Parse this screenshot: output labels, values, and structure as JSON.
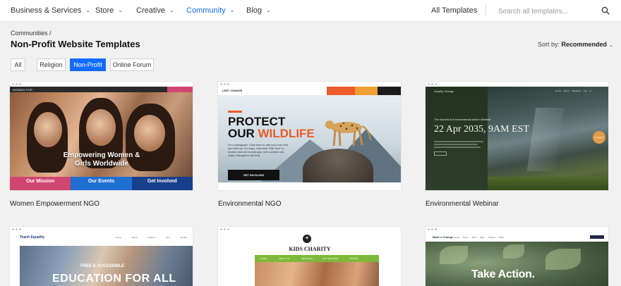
{
  "nav": {
    "items": [
      {
        "label": "Business & Services"
      },
      {
        "label": "Store"
      },
      {
        "label": "Creative"
      },
      {
        "label": "Community",
        "active": true
      },
      {
        "label": "Blog"
      }
    ],
    "all_templates": "All Templates",
    "search_placeholder": "Search all templates...",
    "accent_color": "#116dff"
  },
  "header": {
    "breadcrumb": "Communities /",
    "title": "Non-Profit Website Templates",
    "sort_label": "Sort by:",
    "sort_value": "Recommended"
  },
  "filters": [
    {
      "label": "All",
      "selected": false
    },
    {
      "label": "Religion",
      "selected": false
    },
    {
      "label": "Non-Profit",
      "selected": true
    },
    {
      "label": "Online Forum",
      "selected": false
    }
  ],
  "templates": [
    {
      "name": "Women Empowerment NGO",
      "preview": {
        "logo": "WOMEN FOR",
        "headline": "Empowering Women & Girls Worldwide",
        "cells": [
          {
            "label": "Our Mission",
            "color": "#d04671"
          },
          {
            "label": "Our Events",
            "color": "#1f6fd1"
          },
          {
            "label": "Get Involved",
            "color": "#173f8a"
          }
        ]
      }
    },
    {
      "name": "Environmental NGO",
      "preview": {
        "logo": "LEST CHANCE",
        "headline_line1": "PROTECT",
        "headline_line2a": "OUR ",
        "headline_line2b": "WILDLIFE",
        "body": "I'm a paragraph. Click here to add your own text and edit me. It's easy. Just click \"Edit Text\" or double click me to add your own content and make changes to the font.",
        "cta": "GET INVOLVED"
      }
    },
    {
      "name": "Environmental Webinar",
      "preview": {
        "logo": "Amplify Change",
        "menu": "Home About Speakers Log In",
        "small": "The Secrets to Environmental Action Webinar",
        "date": "22 Apr 2035, 9AM EST",
        "button": "Register"
      }
    },
    {
      "name": "",
      "preview": {
        "logo": "Teach Equality",
        "menu": "Home About Projects Join Donate",
        "sub": "FREE & ACCESSIBLE",
        "headline": "EDUCATION FOR ALL"
      }
    },
    {
      "name": "",
      "preview": {
        "title": "KIDS CHARITY",
        "menu": [
          "HOME",
          "ABOUT US",
          "PROJECTS",
          "GET INVOLVED",
          "DONATE"
        ]
      }
    },
    {
      "name": "",
      "preview": {
        "logo": "Make a Change",
        "menu": "Home About Team Blog Projects Shop",
        "headline": "Take Action."
      }
    }
  ]
}
